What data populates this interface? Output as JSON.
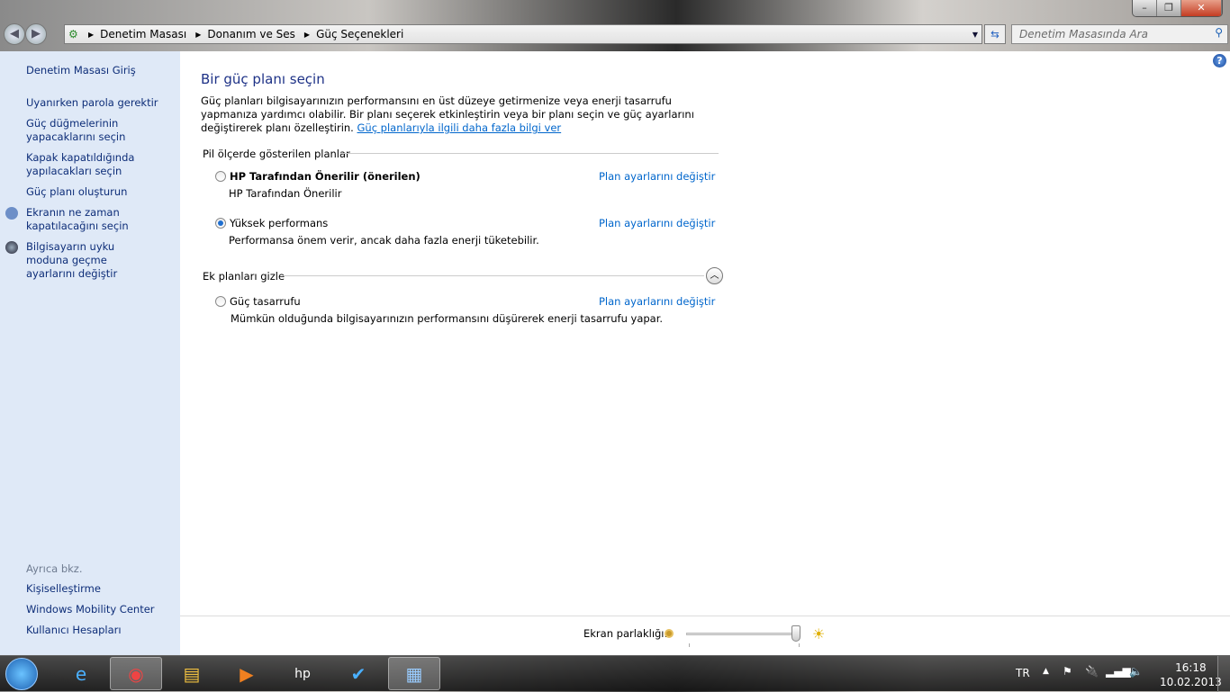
{
  "window": {
    "minimize": "–",
    "maximize": "❐",
    "close": "✕"
  },
  "address": {
    "crumbs": [
      "Denetim Masası",
      "Donanım ve Ses",
      "Güç Seçenekleri"
    ]
  },
  "search": {
    "placeholder": "Denetim Masasında Ara"
  },
  "sidebar": {
    "home": "Denetim Masası Giriş",
    "items": [
      "Uyanırken parola gerektir",
      "Güç düğmelerinin yapacaklarını seçin",
      "Kapak kapatıldığında yapılacakları seçin",
      "Güç planı oluşturun",
      "Ekranın ne zaman kapatılacağını seçin",
      "Bilgisayarın uyku moduna geçme ayarlarını değiştir"
    ],
    "see_also": "Ayrıca bkz.",
    "links": [
      "Kişiselleştirme",
      "Windows Mobility Center",
      "Kullanıcı Hesapları"
    ]
  },
  "main": {
    "title": "Bir güç planı seçin",
    "intro": "Güç planları bilgisayarınızın performansını en üst düzeye getirmenize veya enerji tasarrufu yapmanıza yardımcı olabilir. Bir planı seçerek etkinleştirin veya bir planı seçin ve güç ayarlarını değiştirerek planı özelleştirin.",
    "intro_link": "Güç planlarıyla ilgili daha fazla bilgi ver",
    "group1": "Pil ölçerde gösterilen planlar",
    "group2": "Ek planları gizle",
    "change_label": "Plan ayarlarını değiştir",
    "plans": [
      {
        "name": "HP Tarafından Önerilir (önerilen)",
        "desc": "HP Tarafından Önerilir",
        "selected": false
      },
      {
        "name": "Yüksek performans",
        "desc": "Performansa önem verir, ancak daha fazla enerji tüketebilir.",
        "selected": true
      },
      {
        "name": "Güç tasarrufu",
        "desc": "Mümkün olduğunda bilgisayarınızın performansını düşürerek enerji tasarrufu yapar.",
        "selected": false
      }
    ]
  },
  "brightness": {
    "label": "Ekran parlaklığı:",
    "value_percent": 100
  },
  "taskbar": {
    "lang": "TR",
    "time": "16:18",
    "date": "10.02.2013",
    "apps": [
      "internet-explorer",
      "chrome",
      "explorer",
      "media-player",
      "hp",
      "task-app",
      "control-panel"
    ]
  }
}
